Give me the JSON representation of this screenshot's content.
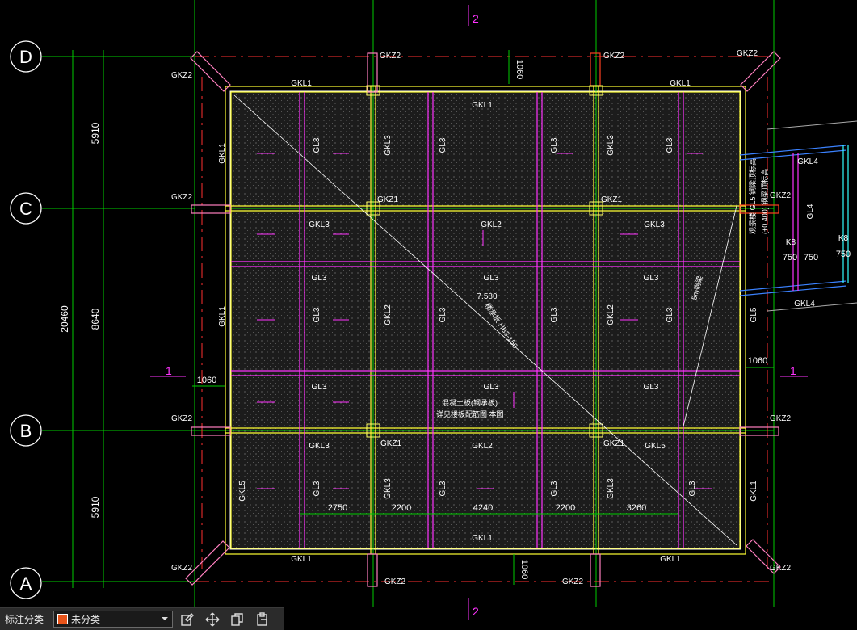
{
  "grid_axes": {
    "rows": [
      "D",
      "C",
      "B",
      "A"
    ],
    "cols": [
      "1",
      "1",
      "2",
      "2"
    ]
  },
  "dimensions": {
    "vertical": {
      "total": "20460",
      "d_c": "5910",
      "c_b": "8640",
      "b_a": "5910"
    },
    "bottom": [
      "2750",
      "2200",
      "4240",
      "2200",
      "3260"
    ],
    "offset_1060": "1060",
    "side_750": "750"
  },
  "labels": {
    "gkz2": "GKZ2",
    "gkz1": "GKZ1",
    "gkl1": "GKL1",
    "gkl2": "GKL2",
    "gkl3": "GKL3",
    "gkl4": "GKL4",
    "gkl5": "GKL5",
    "gl3": "GL3",
    "gl4": "GL4",
    "gl5": "GL5",
    "k8": "K8",
    "elev": "7.580",
    "slab_note": "楼承板 HB3-150",
    "conc_note_1": "混凝土板(钢承板)",
    "conc_note_2": "详见楼板配筋图 本图",
    "diag_note": "5m钢梁",
    "side_note_1": "观景楼 GL5 钢梁顶标高",
    "side_note_2": "(+0.400) 钢梁顶标高"
  },
  "toolbar": {
    "label": "标注分类",
    "selected": "未分类",
    "swatch_color": "#e8541a",
    "tools": [
      "edit-icon",
      "move-icon",
      "copy-icon",
      "paste-icon"
    ]
  },
  "colors": {
    "grid": "#00ff00",
    "axis_red": "#ff3030",
    "beam_main": "#ffff33",
    "beam_sec": "#ff33ff",
    "column": "#ff7fbf",
    "label": "#ffffff",
    "blue": "#3b82ff",
    "cyan": "#33ffff"
  }
}
